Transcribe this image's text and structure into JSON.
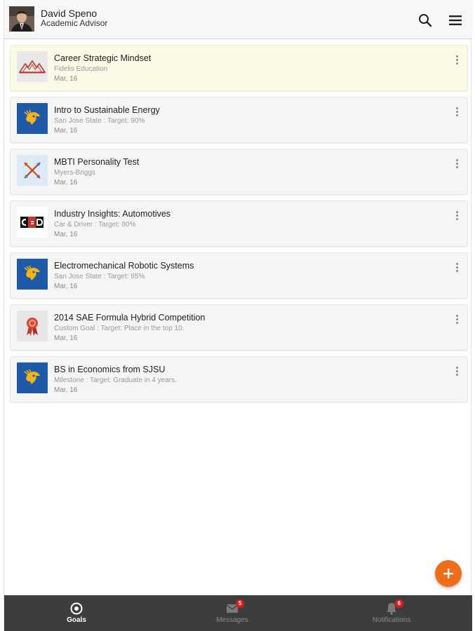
{
  "header": {
    "user_name": "David Speno",
    "user_role": "Academic Advisor",
    "search_icon": "search-icon",
    "menu_icon": "hamburger-menu-icon"
  },
  "goals": [
    {
      "title": "Career Strategic Mindset",
      "subtitle": "Fidelis Education",
      "date": "Mar, 16",
      "logo": "fidelis-logo",
      "highlighted": true
    },
    {
      "title": "Intro to Sustainable Energy",
      "subtitle": "San Jose State : Target: 90%",
      "date": "Mar, 16",
      "logo": "sjsu-spartan-logo",
      "highlighted": false
    },
    {
      "title": "MBTI Personality Test",
      "subtitle": "Myers-Briggs",
      "date": "Mar, 16",
      "logo": "mbti-logo",
      "highlighted": false
    },
    {
      "title": "Industry Insights: Automotives",
      "subtitle": "Car & Driver : Target: 80%",
      "date": "Mar, 16",
      "logo": "car-and-driver-logo",
      "highlighted": false
    },
    {
      "title": "Electromechanical Robotic Systems",
      "subtitle": "San Jose State : Target: 85%",
      "date": "Mar, 16",
      "logo": "sjsu-spartan-logo",
      "highlighted": false
    },
    {
      "title": "2014 SAE Formula Hybrid Competition",
      "subtitle": "Custom Goal : Target: Place in the top 10.",
      "date": "Mar, 16",
      "logo": "award-ribbon-icon",
      "highlighted": false
    },
    {
      "title": "BS in Economics from SJSU",
      "subtitle": "Milestone : Target: Graduate in 4 years.",
      "date": "Mar, 16",
      "logo": "sjsu-spartan-logo",
      "highlighted": false
    }
  ],
  "fab": {
    "icon": "plus-icon"
  },
  "bottom_nav": [
    {
      "label": "Goals",
      "icon": "target-icon",
      "active": true,
      "badge": ""
    },
    {
      "label": "Messages",
      "icon": "envelope-icon",
      "active": false,
      "badge": "5"
    },
    {
      "label": "Notifications",
      "icon": "bell-icon",
      "active": false,
      "badge": "6"
    }
  ],
  "colors": {
    "accent": "#ef6c1b",
    "highlight_card": "#fbfae6",
    "nav_background": "#3d3d3d",
    "badge": "#e01b1b",
    "sjsu_blue": "#1f5aa8",
    "sjsu_gold": "#f2b418"
  }
}
